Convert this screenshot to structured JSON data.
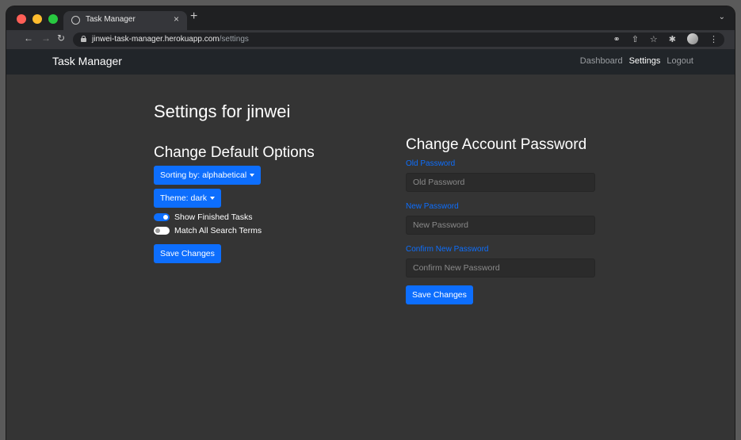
{
  "browser": {
    "tab_title": "Task Manager",
    "tab_close": "×",
    "new_tab": "+",
    "url_host": "jinwei-task-manager.herokuapp.com",
    "url_path": "/settings"
  },
  "navbar": {
    "brand": "Task Manager",
    "links": [
      {
        "label": "Dashboard",
        "active": false
      },
      {
        "label": "Settings",
        "active": true
      },
      {
        "label": "Logout",
        "active": false
      }
    ]
  },
  "page": {
    "title": "Settings for jinwei"
  },
  "default_options": {
    "title": "Change Default Options",
    "sort_button": "Sorting by: alphabetical",
    "theme_button": "Theme: dark",
    "toggles": [
      {
        "label": "Show Finished Tasks",
        "checked": true
      },
      {
        "label": "Match All Search Terms",
        "checked": false
      }
    ],
    "save_button": "Save Changes"
  },
  "password": {
    "title": "Change Account Password",
    "old_label": "Old Password",
    "old_placeholder": "Old Password",
    "new_label": "New Password",
    "new_placeholder": "New Password",
    "confirm_label": "Confirm New Password",
    "confirm_placeholder": "Confirm New Password",
    "save_button": "Save Changes"
  },
  "colors": {
    "accent": "#0d6efd",
    "navbar_bg": "#212529",
    "page_bg": "#343434"
  }
}
